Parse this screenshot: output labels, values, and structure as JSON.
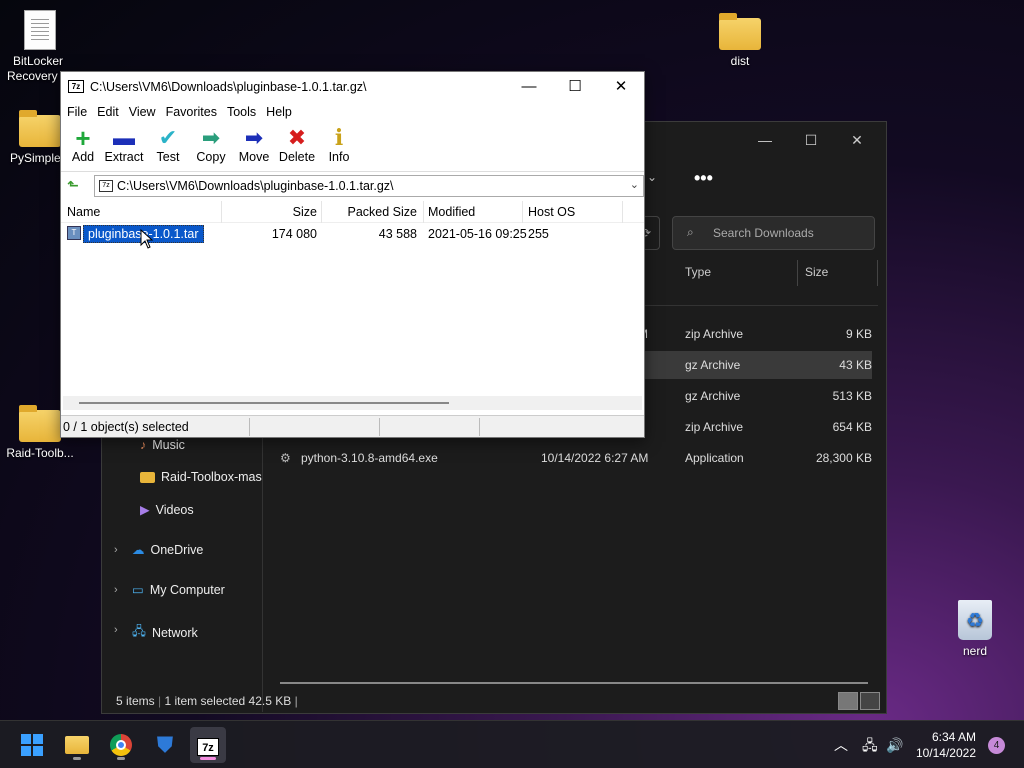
{
  "desktop": {
    "icons": [
      {
        "label": "BitLocker Recovery K",
        "icon": "text-document-icon"
      },
      {
        "label": "PySimpleG",
        "icon": "folder-icon"
      },
      {
        "label": "Raid-Toolb...",
        "icon": "folder-icon"
      },
      {
        "label": "dist",
        "icon": "folder-icon"
      },
      {
        "label": "nerd",
        "icon": "recycle-bin-icon"
      }
    ]
  },
  "explorer": {
    "title_buttons": [
      "—",
      "☐",
      "✕"
    ],
    "more": "•••",
    "search_placeholder": "Search Downloads",
    "columns": {
      "type": "Type",
      "size": "Size"
    },
    "rows": [
      {
        "name": "",
        "modified": "M",
        "type": "zip Archive",
        "size": "9 KB"
      },
      {
        "name": "",
        "modified": "",
        "type": "gz Archive",
        "size": "43 KB",
        "selected": true
      },
      {
        "name": "",
        "modified": "",
        "type": "gz Archive",
        "size": "513 KB"
      },
      {
        "name": "",
        "modified": "",
        "type": "zip Archive",
        "size": "654 KB"
      },
      {
        "name": "python-3.10.8-amd64.exe",
        "modified": "10/14/2022 6:27 AM",
        "type": "Application",
        "size": "28,300 KB"
      }
    ],
    "nav": {
      "music": "Music",
      "raid": "Raid-Toolbox-mas",
      "videos": "Videos",
      "onedrive": "OneDrive",
      "mycomputer": "My Computer",
      "network": "Network"
    },
    "status": {
      "items": "5 items",
      "selected": "1 item selected",
      "size": "42.5 KB"
    }
  },
  "zip": {
    "logo": "7z",
    "title": "C:\\Users\\VM6\\Downloads\\pluginbase-1.0.1.tar.gz\\",
    "menu": [
      "File",
      "Edit",
      "View",
      "Favorites",
      "Tools",
      "Help"
    ],
    "toolbar": [
      {
        "label": "Add",
        "glyph": "+",
        "color": "#1fa83a"
      },
      {
        "label": "Extract",
        "glyph": "▬",
        "color": "#1c2fb8"
      },
      {
        "label": "Test",
        "glyph": "✔",
        "color": "#2bb3c8"
      },
      {
        "label": "Copy",
        "glyph": "➡",
        "color": "#2a9e7c"
      },
      {
        "label": "Move",
        "glyph": "➡",
        "color": "#1c2fb8"
      },
      {
        "label": "Delete",
        "glyph": "✖",
        "color": "#d61d1d"
      },
      {
        "label": "Info",
        "glyph": "i",
        "color": "#c9a21a"
      }
    ],
    "address": "C:\\Users\\VM6\\Downloads\\pluginbase-1.0.1.tar.gz\\",
    "columns": {
      "name": "Name",
      "size": "Size",
      "packed": "Packed Size",
      "modified": "Modified",
      "host": "Host OS"
    },
    "row": {
      "name": "pluginbase-1.0.1.tar",
      "size": "174 080",
      "packed": "43 588",
      "modified": "2021-05-16 09:25",
      "host": "255"
    },
    "status": "0 / 1 object(s) selected"
  },
  "taskbar": {
    "clock_time": "6:34 AM",
    "clock_date": "10/14/2022",
    "notifications": "4",
    "zip_label": "7z"
  }
}
